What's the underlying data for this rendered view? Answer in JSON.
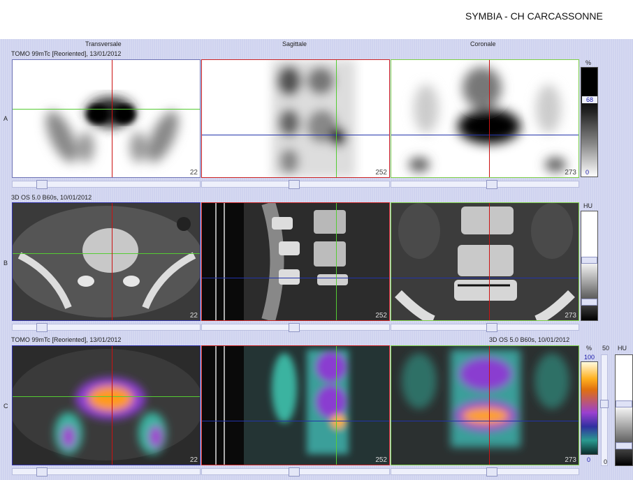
{
  "header": {
    "brand": "SYMBIA - CH CARCASSONNE"
  },
  "columns": [
    "Transversale",
    "Sagittale",
    "Coronale"
  ],
  "rows": [
    {
      "label": "A",
      "info": "TOMO 99mTc [Reoriented], 13/01/2012"
    },
    {
      "label": "B",
      "info": "3D  OS  5.0  B60s, 10/01/2012"
    },
    {
      "label": "C",
      "info": "TOMO 99mTc [Reoriented], 13/01/2012",
      "info_right": "3D  OS  5.0  B60s, 10/01/2012"
    }
  ],
  "slices": [
    "22",
    "252",
    "273"
  ],
  "colorbars": {
    "a": {
      "unit": "%",
      "value": "68",
      "min": "0"
    },
    "b": {
      "unit": "HU"
    },
    "c": {
      "unit": "%",
      "max": "100",
      "min": "0",
      "fusion_value": "50",
      "unit2": "HU",
      "bottom": "0"
    }
  },
  "colors": {
    "transversal": "#cc1111",
    "sagittal_frame": "#cc2222",
    "coronal_frame": "#7ccf45",
    "crosshair_h": "#2233aa",
    "workspace": "#cfd3ef"
  }
}
